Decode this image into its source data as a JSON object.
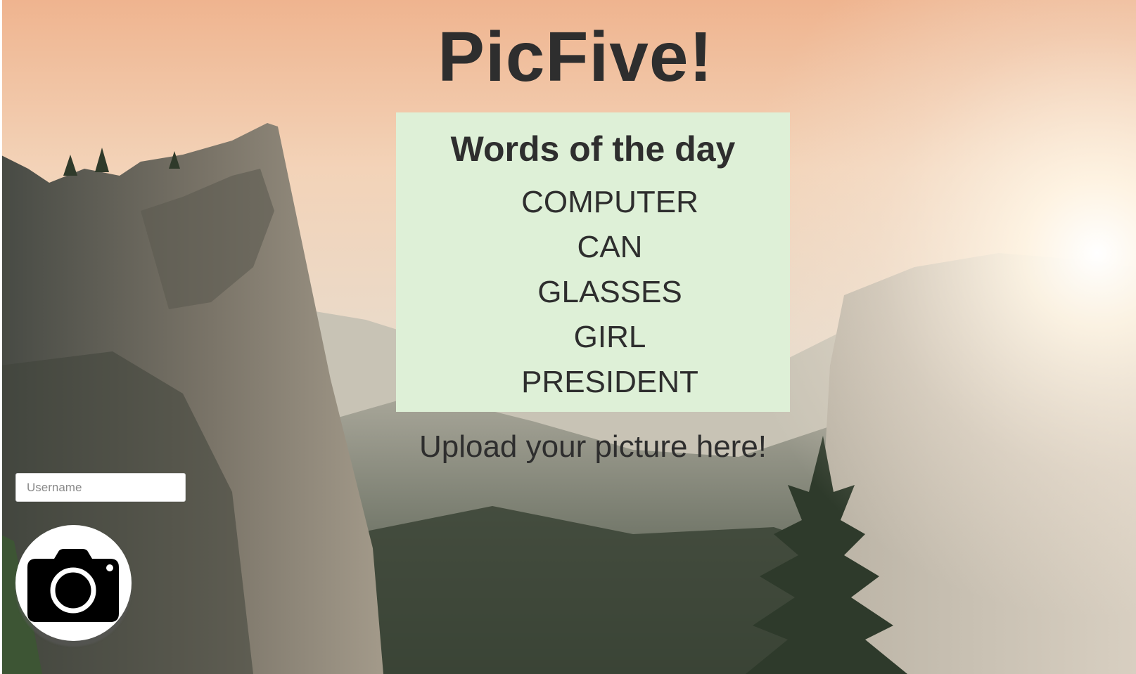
{
  "app": {
    "title": "PicFive!"
  },
  "words_panel": {
    "heading": "Words of the day",
    "words": [
      "COMPUTER",
      "CAN",
      "GLASSES",
      "GIRL",
      "PRESIDENT"
    ],
    "background_color": "#def0d7"
  },
  "upload": {
    "prompt": "Upload your picture here!"
  },
  "username": {
    "placeholder": "Username",
    "value": ""
  },
  "camera": {
    "icon": "camera-icon"
  },
  "theme": {
    "text_color": "#2e2e2e",
    "background": "mountain-valley-sunrise-photo"
  }
}
